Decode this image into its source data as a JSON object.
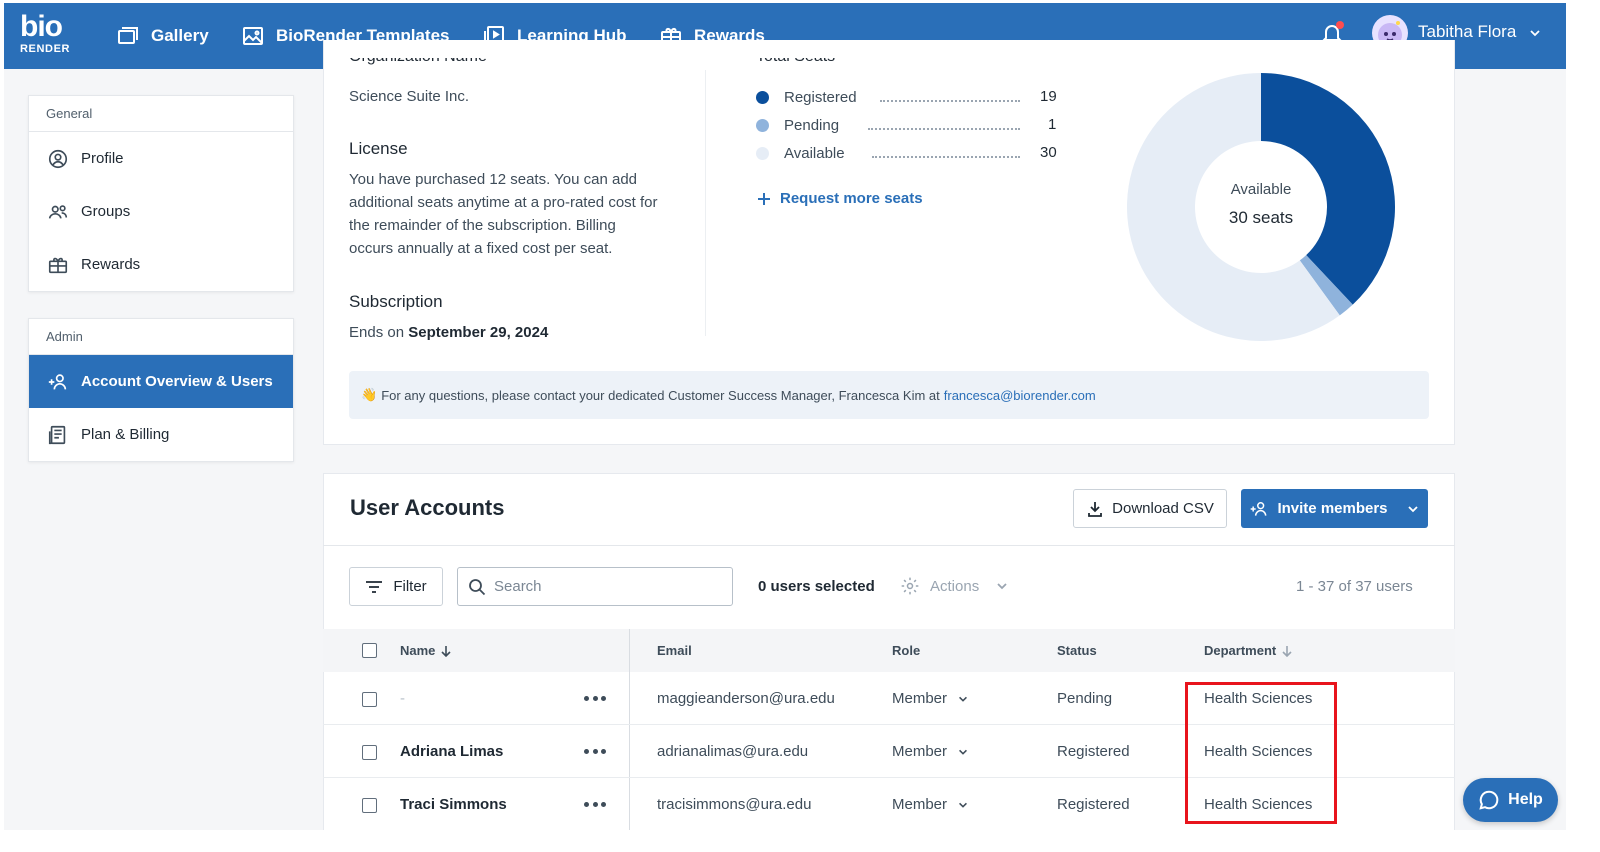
{
  "topnav": {
    "logo_top": "bio",
    "logo_bottom": "RENDER",
    "items": [
      {
        "label": "Gallery",
        "icon": "gallery-icon"
      },
      {
        "label": "BioRender Templates",
        "icon": "templates-icon"
      },
      {
        "label": "Learning Hub",
        "icon": "learning-hub-icon"
      },
      {
        "label": "Rewards",
        "icon": "rewards-icon"
      }
    ],
    "user_name": "Tabitha Flora"
  },
  "sidebar": {
    "general": {
      "heading": "General",
      "items": [
        {
          "label": "Profile",
          "icon": "profile-icon"
        },
        {
          "label": "Groups",
          "icon": "groups-icon"
        },
        {
          "label": "Rewards",
          "icon": "rewards-icon"
        }
      ]
    },
    "admin": {
      "heading": "Admin",
      "items": [
        {
          "label": "Account Overview & Users",
          "icon": "add-user-icon",
          "active": true
        },
        {
          "label": "Plan & Billing",
          "icon": "billing-icon"
        }
      ]
    }
  },
  "overview": {
    "org_label": "Organization Name",
    "org_value": "Science Suite Inc.",
    "license_title": "License",
    "license_text": "You have purchased 12 seats. You can add additional seats anytime at a pro-rated cost for the remainder of the subscription. Billing occurs annually at a fixed cost per seat.",
    "subscription_title": "Subscription",
    "subscription_prefix": "Ends on",
    "subscription_date": "September 29, 2024",
    "seats_label": "Total Seats",
    "seats": [
      {
        "label": "Registered",
        "value": 19,
        "color": "#0b4f9c"
      },
      {
        "label": "Pending",
        "value": 1,
        "color": "#8fb3dc"
      },
      {
        "label": "Available",
        "value": 30,
        "color": "#e6edf6"
      }
    ],
    "request_link": "Request more seats",
    "donut_label": "Available",
    "donut_value": "30 seats",
    "info_emoji": "👋",
    "info_text": "For any questions, please contact your dedicated Customer Success Manager, Francesca Kim at",
    "info_email": "francesca@biorender.com"
  },
  "users": {
    "title": "User Accounts",
    "download_label": "Download CSV",
    "invite_label": "Invite members",
    "filter_label": "Filter",
    "search_placeholder": "Search",
    "selected_text": "0 users selected",
    "actions_label": "Actions",
    "pager_text": "1 - 37 of 37 users",
    "columns": {
      "name": "Name",
      "email": "Email",
      "role": "Role",
      "status": "Status",
      "department": "Department"
    },
    "rows": [
      {
        "name": "-",
        "email": "maggieanderson@ura.edu",
        "role": "Member",
        "status": "Pending",
        "department": "Health Sciences"
      },
      {
        "name": "Adriana Limas",
        "email": "adrianalimas@ura.edu",
        "role": "Member",
        "status": "Registered",
        "department": "Health Sciences"
      },
      {
        "name": "Traci Simmons",
        "email": "tracisimmons@ura.edu",
        "role": "Member",
        "status": "Registered",
        "department": "Health Sciences"
      }
    ]
  },
  "help_label": "Help",
  "colors": {
    "brand": "#2a6fb8",
    "highlight": "#e8141c"
  }
}
